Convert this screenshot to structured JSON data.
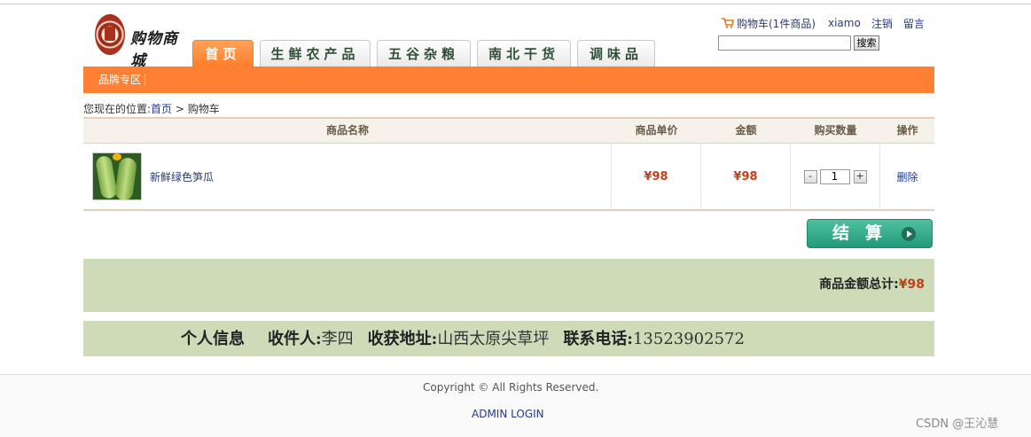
{
  "header": {
    "logo_text": "购物商城",
    "nav_tabs": [
      {
        "label": "首页",
        "active": true
      },
      {
        "label": "生鲜农产品",
        "active": false
      },
      {
        "label": "五谷杂粮",
        "active": false
      },
      {
        "label": "南北干货",
        "active": false
      },
      {
        "label": "调味品",
        "active": false
      }
    ],
    "cart_link": "购物车(1件商品)",
    "username": "xiamo",
    "logout": "注销",
    "message": "留言",
    "search_placeholder": "",
    "search_button": "搜索"
  },
  "subnav": {
    "brand_zone": "品牌专区"
  },
  "breadcrumb": {
    "prefix": "您现在的位置:",
    "home": "首页",
    "separator": " > ",
    "current": "购物车"
  },
  "cart": {
    "columns": [
      "商品名称",
      "商品单价",
      "金额",
      "购买数量",
      "操作"
    ],
    "items": [
      {
        "name": "新鲜绿色笋瓜",
        "unit_price": "¥98",
        "amount": "¥98",
        "quantity": "1",
        "delete_label": "删除",
        "minus": "-",
        "plus": "+"
      }
    ],
    "checkout_label": "结算",
    "total_label": "商品金额总计:",
    "total_value": "¥98"
  },
  "receiver": {
    "title": "个人信息",
    "name_label": "收件人:",
    "name_value": "李四",
    "address_label": "收获地址:",
    "address_value": "山西太原尖草坪",
    "phone_label": "联系电话:",
    "phone_value": "13523902572"
  },
  "footer": {
    "copyright": "Copyright © All Rights Reserved.",
    "admin_login": "ADMIN LOGIN",
    "watermark": "CSDN @王沁慧"
  },
  "colors": {
    "accent_orange": "#ff8033",
    "checkout_green": "#239b7a",
    "panel_green": "#cddbb9",
    "price_red": "#c0401a",
    "link_blue": "#253a8a"
  },
  "icons": [
    "cart-icon",
    "product-thumbnail",
    "play-arrow-icon",
    "logo-seal"
  ]
}
